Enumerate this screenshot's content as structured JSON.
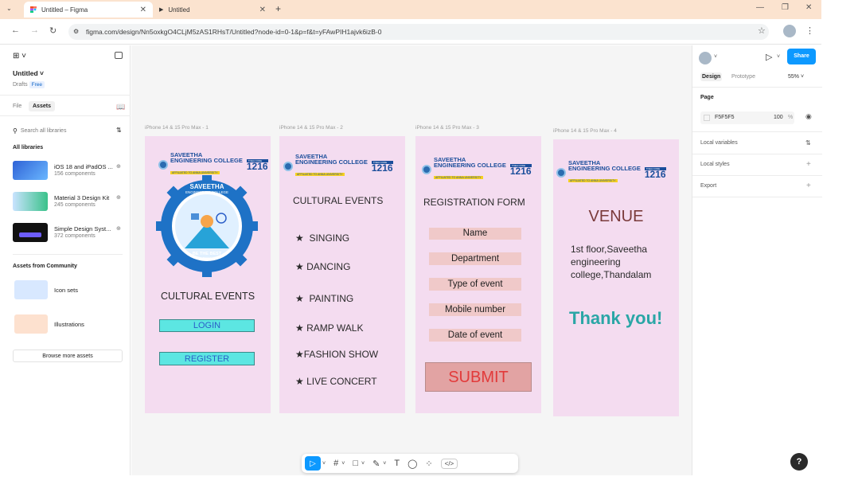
{
  "browser": {
    "tabs": [
      {
        "title": "Untitled – Figma",
        "close": "✕"
      },
      {
        "title": "Untitled",
        "close": "✕"
      }
    ],
    "new_tab": "+",
    "url": "figma.com/design/Nn5oxkgO4CLjM5zAS1RHsT/Untitled?node-id=0-1&p=f&t=yFAwPIH1ajvk6izB-0",
    "window_buttons": [
      "—",
      "❐",
      "✕"
    ]
  },
  "left_panel": {
    "file_name": "Untitled",
    "drafts": "Drafts",
    "plan": "Free",
    "tab_file": "File",
    "tab_assets": "Assets",
    "search_placeholder": "Search all libraries",
    "all_libraries": "All libraries",
    "libraries": [
      {
        "name": "iOS 18 and iPadOS ...",
        "count": "156 components",
        "color": "#3a6fd8"
      },
      {
        "name": "Material 3 Design Kit",
        "count": "245 components",
        "color": "#3ac28a"
      },
      {
        "name": "Simple Design Syst...",
        "count": "372 components",
        "color": "#111111"
      }
    ],
    "community_heading": "Assets from Community",
    "community": [
      {
        "name": "Icon sets"
      },
      {
        "name": "Illustrations"
      }
    ],
    "browse_button": "Browse more assets"
  },
  "canvas": {
    "frames": [
      {
        "label": "iPhone 14 & 15 Pro Max - 1"
      },
      {
        "label": "iPhone 14 & 15 Pro Max - 2"
      },
      {
        "label": "iPhone 14 & 15 Pro Max - 3"
      },
      {
        "label": "iPhone 14 & 15 Pro Max - 4"
      }
    ],
    "logo": {
      "line1": "SAVEETHA",
      "line2": "ENGINEERING COLLEGE",
      "autonomous": "AUTONOMOUS",
      "affiliated": "AFFILIATED TO ANNA UNIVERSITY",
      "nabad": "TNEA CODE",
      "code": "1216"
    },
    "emblem": {
      "top": "SAVEETHA",
      "sub": "ENGINEERING COLLEGE",
      "motto": "BE THE BEST",
      "year": "2001"
    },
    "frame1": {
      "title": "CULTURAL EVENTS",
      "login": "LOGIN",
      "register": "REGISTER"
    },
    "frame2": {
      "title": "CULTURAL EVENTS",
      "events": [
        "SINGING",
        "DANCING",
        "PAINTING",
        "RAMP WALK",
        "FASHION SHOW",
        "LIVE CONCERT"
      ]
    },
    "frame3": {
      "title": "REGISTRATION FORM",
      "fields": [
        "Name",
        "Department",
        "Type of event",
        "Mobile number",
        "Date of event"
      ],
      "submit": "SUBMIT"
    },
    "frame4": {
      "title": "VENUE",
      "address": "1st floor,Saveetha engineering college,Thandalam",
      "thanks": "Thank you!"
    }
  },
  "toolbar": {
    "tools": [
      "move-tool",
      "frame-tool",
      "shape-tool",
      "pen-tool",
      "text-tool",
      "comment-tool",
      "actions-tool",
      "dev-mode-tool"
    ]
  },
  "right_panel": {
    "share": "Share",
    "tab_design": "Design",
    "tab_prototype": "Prototype",
    "zoom": "55%",
    "page_heading": "Page",
    "page_color": "F5F5F5",
    "page_opacity": "100",
    "percent": "%",
    "local_variables": "Local variables",
    "local_styles": "Local styles",
    "export": "Export"
  },
  "help": "?"
}
